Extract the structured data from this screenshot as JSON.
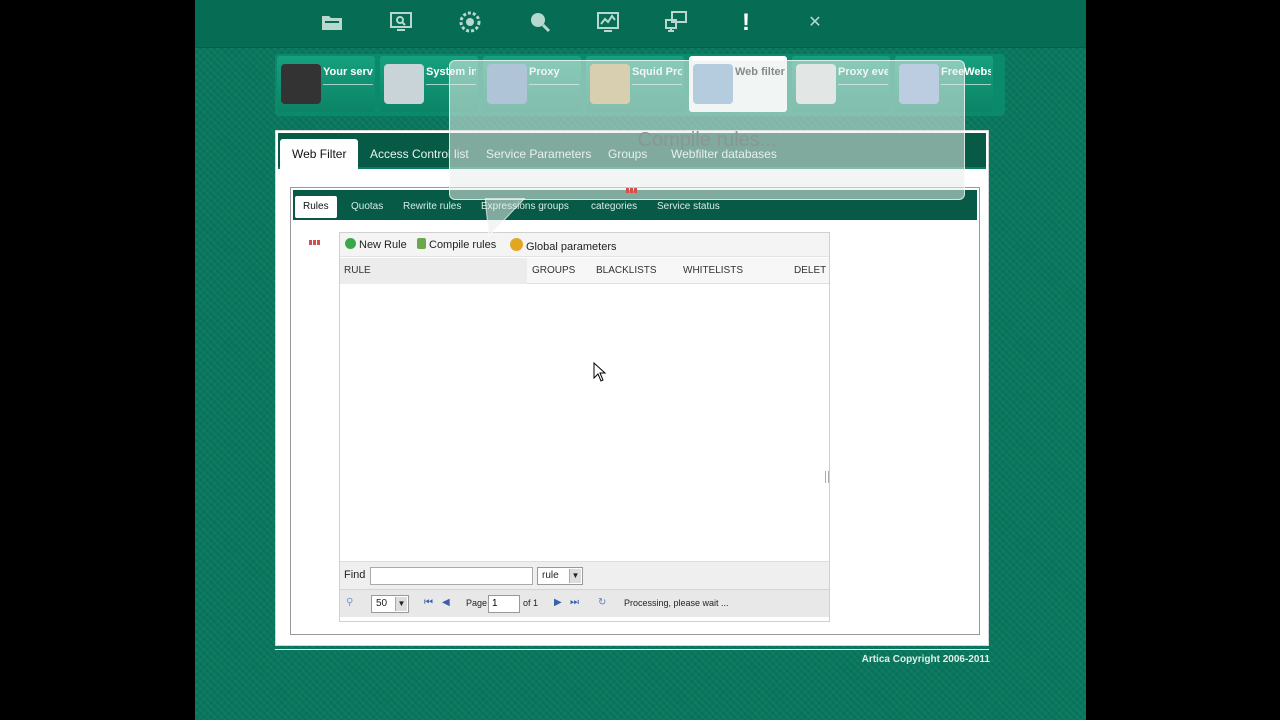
{
  "topbar": {
    "icons": [
      "folder-icon",
      "monitor-search-icon",
      "gear-icon",
      "search-icon",
      "chart-icon",
      "network-icon",
      "alert-icon",
      "close-icon"
    ]
  },
  "apps": [
    {
      "label": "Your serv",
      "icon": "server-icon"
    },
    {
      "label": "System inf",
      "icon": "system-icon"
    },
    {
      "label": "Proxy",
      "icon": "proxy-globe-icon"
    },
    {
      "label": "Squid Proxy web statis",
      "icon": "stats-icon"
    },
    {
      "label": "Web filtering",
      "icon": "web-filter-icon",
      "active": true
    },
    {
      "label": "Proxy eve",
      "icon": "proxy-events-icon"
    },
    {
      "label": "FreeWebs",
      "icon": "freewebs-icon"
    }
  ],
  "main_tabs": [
    "Web Filter",
    "Access Control list",
    "Service Parameters",
    "Groups",
    "Webfilter databases"
  ],
  "sub_tabs": [
    "Rules",
    "Quotas",
    "Rewrite rules",
    "Expressions groups",
    "categories",
    "Service status"
  ],
  "overlay": {
    "text": "Compile rules..."
  },
  "toolbar": {
    "new_rule": "New Rule",
    "compile_rules": "Compile rules",
    "global_parameters": "Global parameters"
  },
  "columns": [
    "RULE",
    "GROUPS",
    "BLACKLISTS",
    "WHITELISTS",
    "",
    "DELET"
  ],
  "find": {
    "label": "Find",
    "value": "",
    "field_select": "rule"
  },
  "pager": {
    "page_size": "50",
    "page_label": "Page",
    "page_value": "1",
    "of_label": "of 1",
    "status": "Processing, please wait ..."
  },
  "footer": {
    "copyright": "Artica Copyright 2006-2011"
  },
  "colors": {
    "brand_green": "#08775d",
    "dark_green": "#075a46",
    "loading_red": "#d05050"
  }
}
